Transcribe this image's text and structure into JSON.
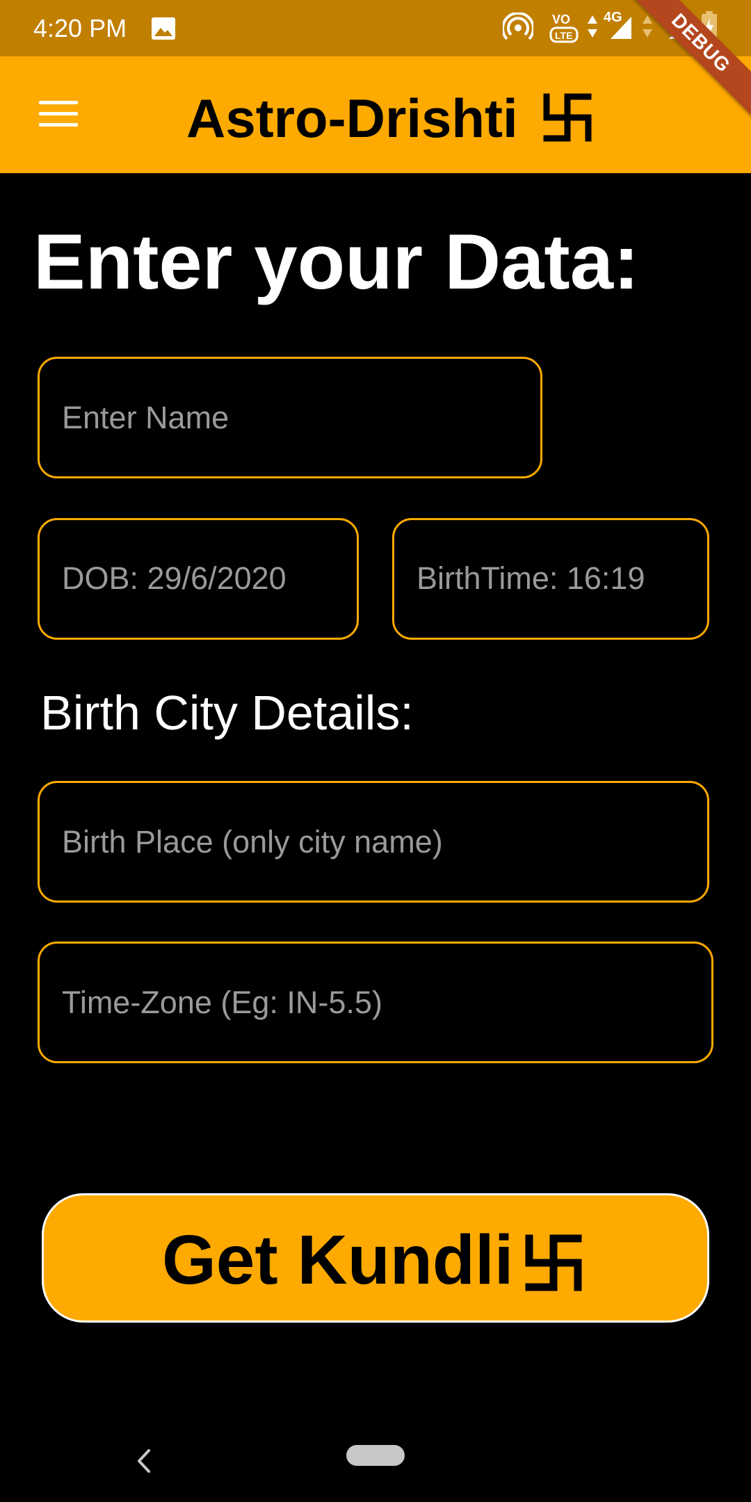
{
  "status_bar": {
    "time": "4:20 PM",
    "network_label": "4G",
    "icons": [
      "gallery-icon",
      "hotspot-icon",
      "volte-icon",
      "data-arrows-icon",
      "signal-icon",
      "battery-icon"
    ]
  },
  "debug_banner": "DEBUG",
  "app_bar": {
    "title": "Astro-Drishti",
    "menu_icon": "menu-icon",
    "title_symbol": "swastika-symbol"
  },
  "form": {
    "heading": "Enter your Data:",
    "name_placeholder": "Enter Name",
    "dob_text": "DOB: 29/6/2020",
    "birthtime_text": "BirthTime: 16:19",
    "city_section_heading": "Birth City Details:",
    "birthplace_placeholder": "Birth Place (only city name)",
    "timezone_placeholder": "Time-Zone (Eg: IN-5.5)"
  },
  "submit_button": {
    "label": "Get Kundli",
    "symbol": "swastika-symbol"
  },
  "nav_bar": {
    "icons": [
      "back-icon",
      "home-pill"
    ]
  },
  "colors": {
    "status_bar": "#C17F00",
    "accent": "#FFAA00",
    "background": "#000000",
    "placeholder": "#9A9A9A",
    "debug_ribbon": "#B4471E"
  }
}
